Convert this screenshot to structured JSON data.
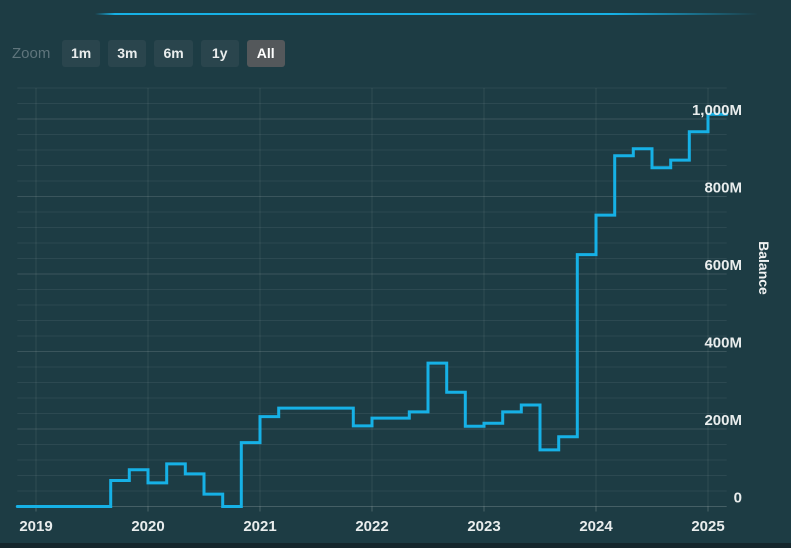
{
  "toolbar": {
    "zoom_label": "Zoom",
    "buttons": [
      {
        "label": "1m",
        "selected": false
      },
      {
        "label": "3m",
        "selected": false
      },
      {
        "label": "6m",
        "selected": false
      },
      {
        "label": "1y",
        "selected": false
      },
      {
        "label": "All",
        "selected": true
      }
    ]
  },
  "chart_data": {
    "type": "line",
    "step": true,
    "title": "",
    "ylabel": "Balance",
    "unit": "M",
    "ylim": [
      0,
      1080
    ],
    "y_tick_interval": 200,
    "y_minor_interval": 40,
    "grid": true,
    "legend": false,
    "y_ticks": [
      {
        "value": 0,
        "label": "0"
      },
      {
        "value": 200,
        "label": "200M"
      },
      {
        "value": 400,
        "label": "400M"
      },
      {
        "value": 600,
        "label": "600M"
      },
      {
        "value": 800,
        "label": "800M"
      },
      {
        "value": 1000,
        "label": "1,000M"
      }
    ],
    "x_ticks": [
      {
        "date": "2019-01",
        "label": "2019"
      },
      {
        "date": "2020-01",
        "label": "2020"
      },
      {
        "date": "2021-01",
        "label": "2021"
      },
      {
        "date": "2022-01",
        "label": "2022"
      },
      {
        "date": "2023-01",
        "label": "2023"
      },
      {
        "date": "2024-01",
        "label": "2024"
      },
      {
        "date": "2025-01",
        "label": "2025"
      }
    ],
    "xlim": [
      "2018-11",
      "2025-03"
    ],
    "series": [
      {
        "name": "Balance",
        "color": "#16b1e6",
        "values_in": "millions",
        "points": [
          [
            "2018-11",
            0
          ],
          [
            "2019-09",
            67
          ],
          [
            "2019-11",
            95
          ],
          [
            "2020-01",
            61
          ],
          [
            "2020-03",
            110
          ],
          [
            "2020-05",
            84
          ],
          [
            "2020-07",
            32
          ],
          [
            "2020-09",
            0
          ],
          [
            "2020-11",
            165
          ],
          [
            "2021-01",
            232
          ],
          [
            "2021-03",
            254
          ],
          [
            "2021-11",
            208
          ],
          [
            "2022-01",
            228
          ],
          [
            "2022-05",
            244
          ],
          [
            "2022-07",
            370
          ],
          [
            "2022-09",
            295
          ],
          [
            "2022-11",
            207
          ],
          [
            "2023-01",
            215
          ],
          [
            "2023-03",
            244
          ],
          [
            "2023-05",
            262
          ],
          [
            "2023-07",
            146
          ],
          [
            "2023-09",
            180
          ],
          [
            "2023-11",
            650
          ],
          [
            "2024-01",
            752
          ],
          [
            "2024-03",
            905
          ],
          [
            "2024-05",
            923
          ],
          [
            "2024-07",
            874
          ],
          [
            "2024-09",
            894
          ],
          [
            "2024-11",
            967
          ],
          [
            "2025-01",
            1012
          ]
        ],
        "end_x": "2025-03"
      }
    ]
  },
  "colors": {
    "background": "#1d3c44",
    "accent_line": "#16b1e6",
    "series": "#16b1e6",
    "button_bg": "#2a454d",
    "button_selected_bg": "#54585b",
    "axis_text": "#e9eded",
    "muted_text": "#5f757c"
  }
}
